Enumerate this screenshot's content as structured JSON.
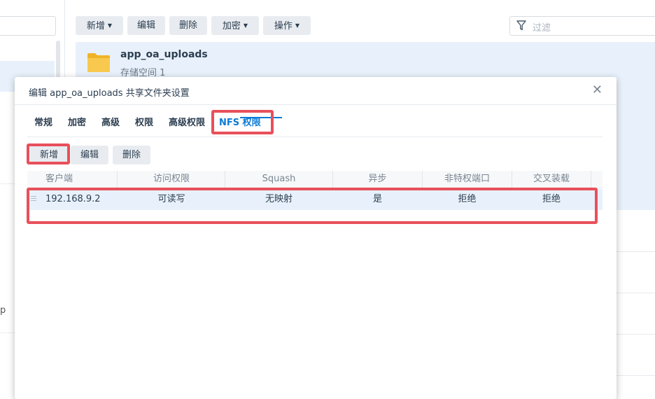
{
  "toolbar": {
    "add": "新增",
    "edit": "编辑",
    "delete": "删除",
    "encrypt": "加密",
    "actions": "操作",
    "filter_placeholder": "过滤"
  },
  "folder": {
    "name": "app_oa_uploads",
    "subtitle": "存储空间 1"
  },
  "left": {
    "partial_glyph": "p"
  },
  "dialog": {
    "title": "编辑 app_oa_uploads 共享文件夹设置",
    "tabs": [
      "常规",
      "加密",
      "高级",
      "权限",
      "高级权限",
      "NFS 权限"
    ],
    "active_tab": "NFS 权限",
    "buttons": {
      "add": "新增",
      "edit": "编辑",
      "delete": "删除"
    },
    "columns": [
      "客户端",
      "访问权限",
      "Squash",
      "异步",
      "非特权端口",
      "交叉装载"
    ],
    "rows": [
      [
        "192.168.9.2",
        "可读写",
        "无映射",
        "是",
        "拒绝",
        "拒绝"
      ]
    ]
  },
  "colors": {
    "accent": "#0b7bd6",
    "selection": "#e8f1fb",
    "highlight": "#e8505b",
    "folder": "#f6c244"
  }
}
